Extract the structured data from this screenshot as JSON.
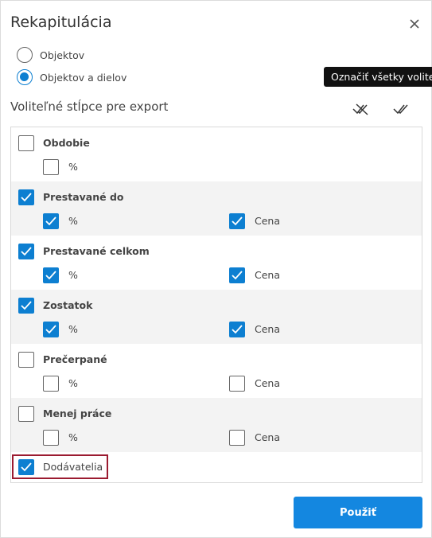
{
  "dialog": {
    "title": "Rekapitulácia"
  },
  "radios": [
    {
      "label": "Objektov",
      "checked": false
    },
    {
      "label": "Objektov a dielov",
      "checked": true
    }
  ],
  "tooltip": "Označiť všetky voliteľné",
  "section_title": "Voliteľné stĺpce pre export",
  "groups": [
    {
      "label": "Obdobie",
      "checked": false,
      "subs": [
        {
          "label": "%",
          "checked": false
        }
      ]
    },
    {
      "label": "Prestavané do",
      "checked": true,
      "subs": [
        {
          "label": "%",
          "checked": true
        },
        {
          "label": "Cena",
          "checked": true
        }
      ]
    },
    {
      "label": "Prestavané celkom",
      "checked": true,
      "subs": [
        {
          "label": "%",
          "checked": true
        },
        {
          "label": "Cena",
          "checked": true
        }
      ]
    },
    {
      "label": "Zostatok",
      "checked": true,
      "subs": [
        {
          "label": "%",
          "checked": true
        },
        {
          "label": "Cena",
          "checked": true
        }
      ]
    },
    {
      "label": "Prečerpané",
      "checked": false,
      "subs": [
        {
          "label": "%",
          "checked": false
        },
        {
          "label": "Cena",
          "checked": false
        }
      ]
    },
    {
      "label": "Menej práce",
      "checked": false,
      "subs": [
        {
          "label": "%",
          "checked": false
        },
        {
          "label": "Cena",
          "checked": false
        }
      ]
    }
  ],
  "last_item": {
    "label": "Dodávatelia",
    "checked": true
  },
  "apply_label": "Použiť",
  "accent_color": "#0d7fd1",
  "highlight_color": "#9b1b30"
}
